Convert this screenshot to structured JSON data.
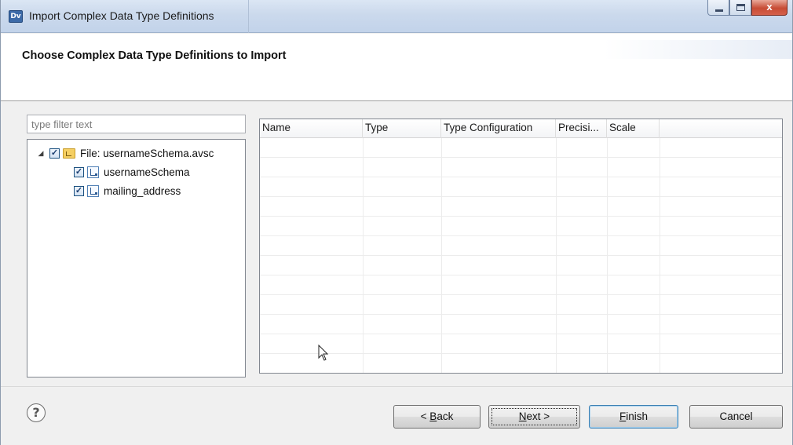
{
  "window": {
    "app_icon_text": "Dv",
    "title": "Import Complex Data Type Definitions",
    "close_glyph": "x"
  },
  "banner": {
    "title": "Choose Complex Data Type Definitions to Import"
  },
  "filter": {
    "placeholder": "type filter text",
    "value": ""
  },
  "tree": {
    "root": {
      "label": "File: usernameSchema.avsc",
      "checked": true,
      "expanded": true,
      "icon": "folder-icon"
    },
    "children": [
      {
        "label": "usernameSchema",
        "checked": true,
        "icon": "schema-icon"
      },
      {
        "label": "mailing_address",
        "checked": true,
        "icon": "schema-icon"
      }
    ]
  },
  "table": {
    "columns": [
      "Name",
      "Type",
      "Type Configuration",
      "Precisi...",
      "Scale"
    ],
    "rows": []
  },
  "buttons": {
    "back_prefix": "< ",
    "back_mnemonic": "B",
    "back_rest": "ack",
    "next_mnemonic": "N",
    "next_rest": "ext >",
    "finish_mnemonic": "F",
    "finish_rest": "inish",
    "cancel": "Cancel"
  },
  "icons": {
    "help": "?",
    "check": "✓",
    "expand_twisty": "◢"
  }
}
